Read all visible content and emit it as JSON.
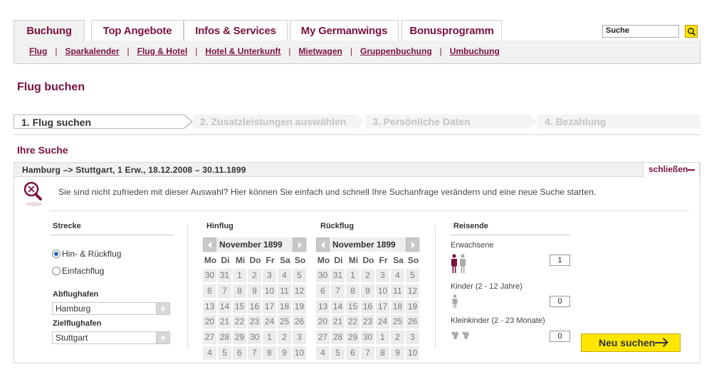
{
  "tabs": [
    {
      "label": "Buchung",
      "active": true
    },
    {
      "label": "Top Angebote",
      "active": false
    },
    {
      "label": "Infos & Services",
      "active": false
    },
    {
      "label": "My Germanwings",
      "active": false
    },
    {
      "label": "Bonusprogramm",
      "active": false
    }
  ],
  "search": {
    "value": "Suche"
  },
  "subnav": [
    "Flug",
    "Sparkalender",
    "Flug & Hotel",
    "Hotel & Unterkunft",
    "Mietwagen",
    "Gruppenbuchung",
    "Umbuchung"
  ],
  "page_title": "Flug buchen",
  "steps": [
    "1. Flug suchen",
    "2. Zusatzleistungen auswählen",
    "3. Persönliche Daten",
    "4. Bezahlung"
  ],
  "section_title": "Ihre Suche",
  "summary": {
    "text": "Hamburg –> Stuttgart, 1 Erw., 18.12.2008 – 30.11.1899",
    "close_label": "schließen"
  },
  "info_text": "Sie sind nicht zufrieden mit dieser Auswahl? Hier können Sie einfach und schnell Ihre Suchanfrage verändern und eine neue Suche starten.",
  "route": {
    "title": "Strecke",
    "options": [
      {
        "label": "Hin- & Rückflug",
        "checked": true
      },
      {
        "label": "Einfachflug",
        "checked": false
      }
    ],
    "departure_label": "Abflughafen",
    "departure_value": "Hamburg",
    "destination_label": "Zielflughafen",
    "destination_value": "Stuttgart"
  },
  "outbound": {
    "title": "Hinflug",
    "month": "November 1899",
    "weekdays": [
      "Mo",
      "Di",
      "Mi",
      "Do",
      "Fr",
      "Sa",
      "So"
    ],
    "days": [
      "30",
      "31",
      "1",
      "2",
      "3",
      "4",
      "5",
      "6",
      "7",
      "8",
      "9",
      "10",
      "11",
      "12",
      "13",
      "14",
      "15",
      "16",
      "17",
      "18",
      "19",
      "20",
      "21",
      "22",
      "23",
      "24",
      "25",
      "26",
      "27",
      "28",
      "29",
      "30",
      "1",
      "2",
      "3",
      "4",
      "5",
      "6",
      "7",
      "8",
      "9",
      "10"
    ]
  },
  "return": {
    "title": "Rückflug",
    "month": "November 1899",
    "weekdays": [
      "Mo",
      "Di",
      "Mi",
      "Do",
      "Fr",
      "Sa",
      "So"
    ],
    "days": [
      "30",
      "31",
      "1",
      "2",
      "3",
      "4",
      "5",
      "6",
      "7",
      "8",
      "9",
      "10",
      "11",
      "12",
      "13",
      "14",
      "15",
      "16",
      "17",
      "18",
      "19",
      "20",
      "21",
      "22",
      "23",
      "24",
      "25",
      "26",
      "27",
      "28",
      "29",
      "30",
      "1",
      "2",
      "3",
      "4",
      "5",
      "6",
      "7",
      "8",
      "9",
      "10"
    ]
  },
  "travellers": {
    "title": "Reisende",
    "adults_label": "Erwachsene",
    "adults_value": "1",
    "children_label": "Kinder (2 - 12 Jahre)",
    "children_value": "0",
    "infants_label": "Kleinkinder (2 - 23 Monate)",
    "infants_value": "0"
  },
  "submit_label": "Neu suchen",
  "colors": {
    "brand": "#7a1240",
    "accent": "#ffe600",
    "radio": "#2f64c8"
  }
}
